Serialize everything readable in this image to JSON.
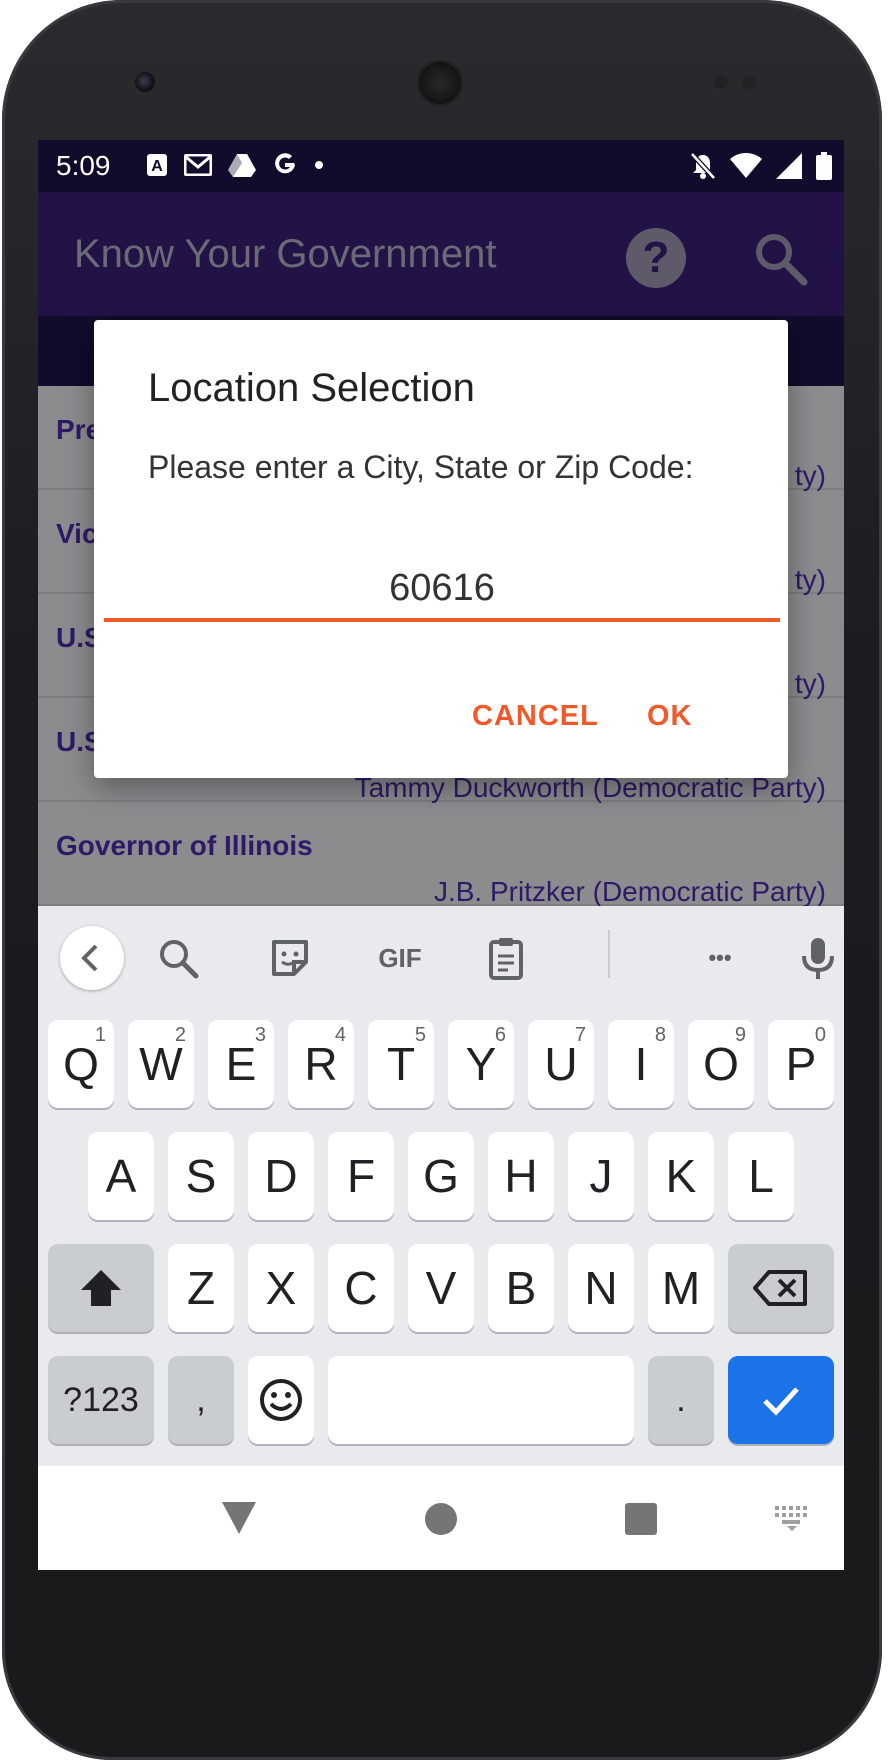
{
  "status_bar": {
    "time": "5:09",
    "left_icons": [
      "a-notification-icon",
      "gmail-icon",
      "drive-icon",
      "google-icon",
      "dot-icon"
    ],
    "right_icons": [
      "mute-icon",
      "wifi-icon",
      "signal-icon",
      "battery-icon"
    ]
  },
  "app_bar": {
    "title": "Know Your Government",
    "help_label": "?"
  },
  "officials": [
    {
      "office": "Pre",
      "person": "ty)"
    },
    {
      "office": "Vic",
      "person": "ty)"
    },
    {
      "office": "U.S",
      "person": "ty)"
    },
    {
      "office": "U.S",
      "person": "Tammy Duckworth  (Democratic Party)"
    },
    {
      "office": "Governor of Illinois",
      "person": "J.B. Pritzker  (Democratic Party)"
    }
  ],
  "dialog": {
    "title": "Location Selection",
    "message": "Please enter a City, State or Zip Code:",
    "input_value": "60616",
    "cancel_label": "CANCEL",
    "ok_label": "OK"
  },
  "keyboard": {
    "toolbar": [
      "back-icon",
      "search-icon",
      "sticker-icon",
      "gif-icon",
      "clipboard-icon",
      "more-icon",
      "mic-icon"
    ],
    "gif_label": "GIF",
    "more_label": "•••",
    "row1": [
      {
        "key": "Q",
        "hint": "1"
      },
      {
        "key": "W",
        "hint": "2"
      },
      {
        "key": "E",
        "hint": "3"
      },
      {
        "key": "R",
        "hint": "4"
      },
      {
        "key": "T",
        "hint": "5"
      },
      {
        "key": "Y",
        "hint": "6"
      },
      {
        "key": "U",
        "hint": "7"
      },
      {
        "key": "I",
        "hint": "8"
      },
      {
        "key": "O",
        "hint": "9"
      },
      {
        "key": "P",
        "hint": "0"
      }
    ],
    "row2": [
      "A",
      "S",
      "D",
      "F",
      "G",
      "H",
      "J",
      "K",
      "L"
    ],
    "row3": [
      "Z",
      "X",
      "C",
      "V",
      "B",
      "N",
      "M"
    ],
    "symbols_label": "?123",
    "comma_label": ",",
    "period_label": "."
  },
  "colors": {
    "accent": "#f05a2a",
    "app_bar": "#221245",
    "status_bar": "#120b2c",
    "enter_key": "#1a73e8"
  }
}
